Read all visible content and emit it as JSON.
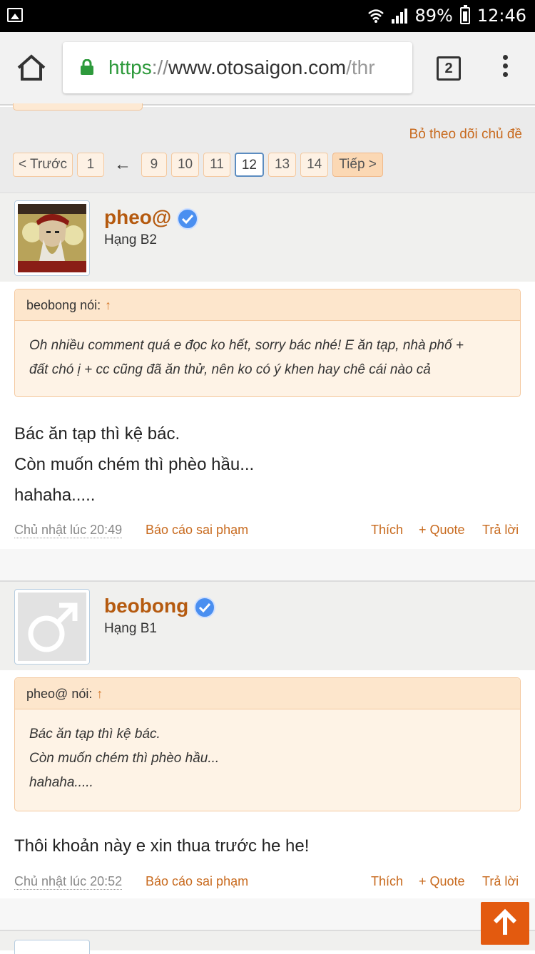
{
  "status_bar": {
    "battery": "89%",
    "time": "12:46"
  },
  "browser": {
    "url_scheme": "https",
    "url_separator": "://",
    "url_host": "www.otosaigon.com",
    "url_rest": "/thr",
    "tab_count": "2"
  },
  "thread": {
    "unwatch_label": "Bỏ theo dõi chủ đề",
    "pagination": {
      "prev": "< Trước",
      "first": "1",
      "arrow": "←",
      "pages": [
        "9",
        "10",
        "11",
        "12",
        "13",
        "14"
      ],
      "current": "12",
      "next": "Tiếp >"
    }
  },
  "posts": [
    {
      "username": "pheo@",
      "rank": "Hạng B2",
      "quote": {
        "author_line": "beobong nói:",
        "up_arrow": "↑",
        "lines": [
          "Oh nhiều comment quá e đọc ko hết, sorry bác nhé! E ăn tạp, nhà phố +",
          "đất chó ị + cc cũng đã ăn thử, nên ko có ý khen hay chê cái nào cả"
        ]
      },
      "message_lines": [
        "Bác ăn tạp thì kệ bác.",
        "Còn muốn chém thì phèo hầu...",
        "hahaha....."
      ],
      "date": "Chủ nhật lúc 20:49",
      "report": "Báo cáo sai phạm",
      "like": "Thích",
      "quote_btn": "+ Quote",
      "reply": "Trả lời"
    },
    {
      "username": "beobong",
      "rank": "Hạng B1",
      "quote": {
        "author_line": "pheo@ nói:",
        "up_arrow": "↑",
        "lines": [
          "Bác ăn tạp thì kệ bác.",
          "Còn muốn chém thì phèo hầu...",
          "hahaha....."
        ]
      },
      "message_lines": [
        "Thôi khoản này e xin thua trước he he!"
      ],
      "date": "Chủ nhật lúc 20:52",
      "report": "Báo cáo sai phạm",
      "like": "Thích",
      "quote_btn": "+ Quote",
      "reply": "Trả lời"
    }
  ],
  "colors": {
    "accent": "#c86a1e",
    "username": "#b55a0f",
    "https_green": "#2e9a3c",
    "scroll_top_button": "#e35a0f",
    "verified_blue": "#4a8ff0"
  },
  "icons": {
    "status_left": "image-icon",
    "wifi": "wifi-icon",
    "signal": "signal-icon",
    "battery": "battery-icon",
    "home": "home-icon",
    "lock": "lock-icon",
    "tabs": "tabs-icon",
    "menu": "menu-icon",
    "verified": "verified-icon",
    "male": "male-symbol-icon",
    "to_top": "arrow-up-icon"
  }
}
